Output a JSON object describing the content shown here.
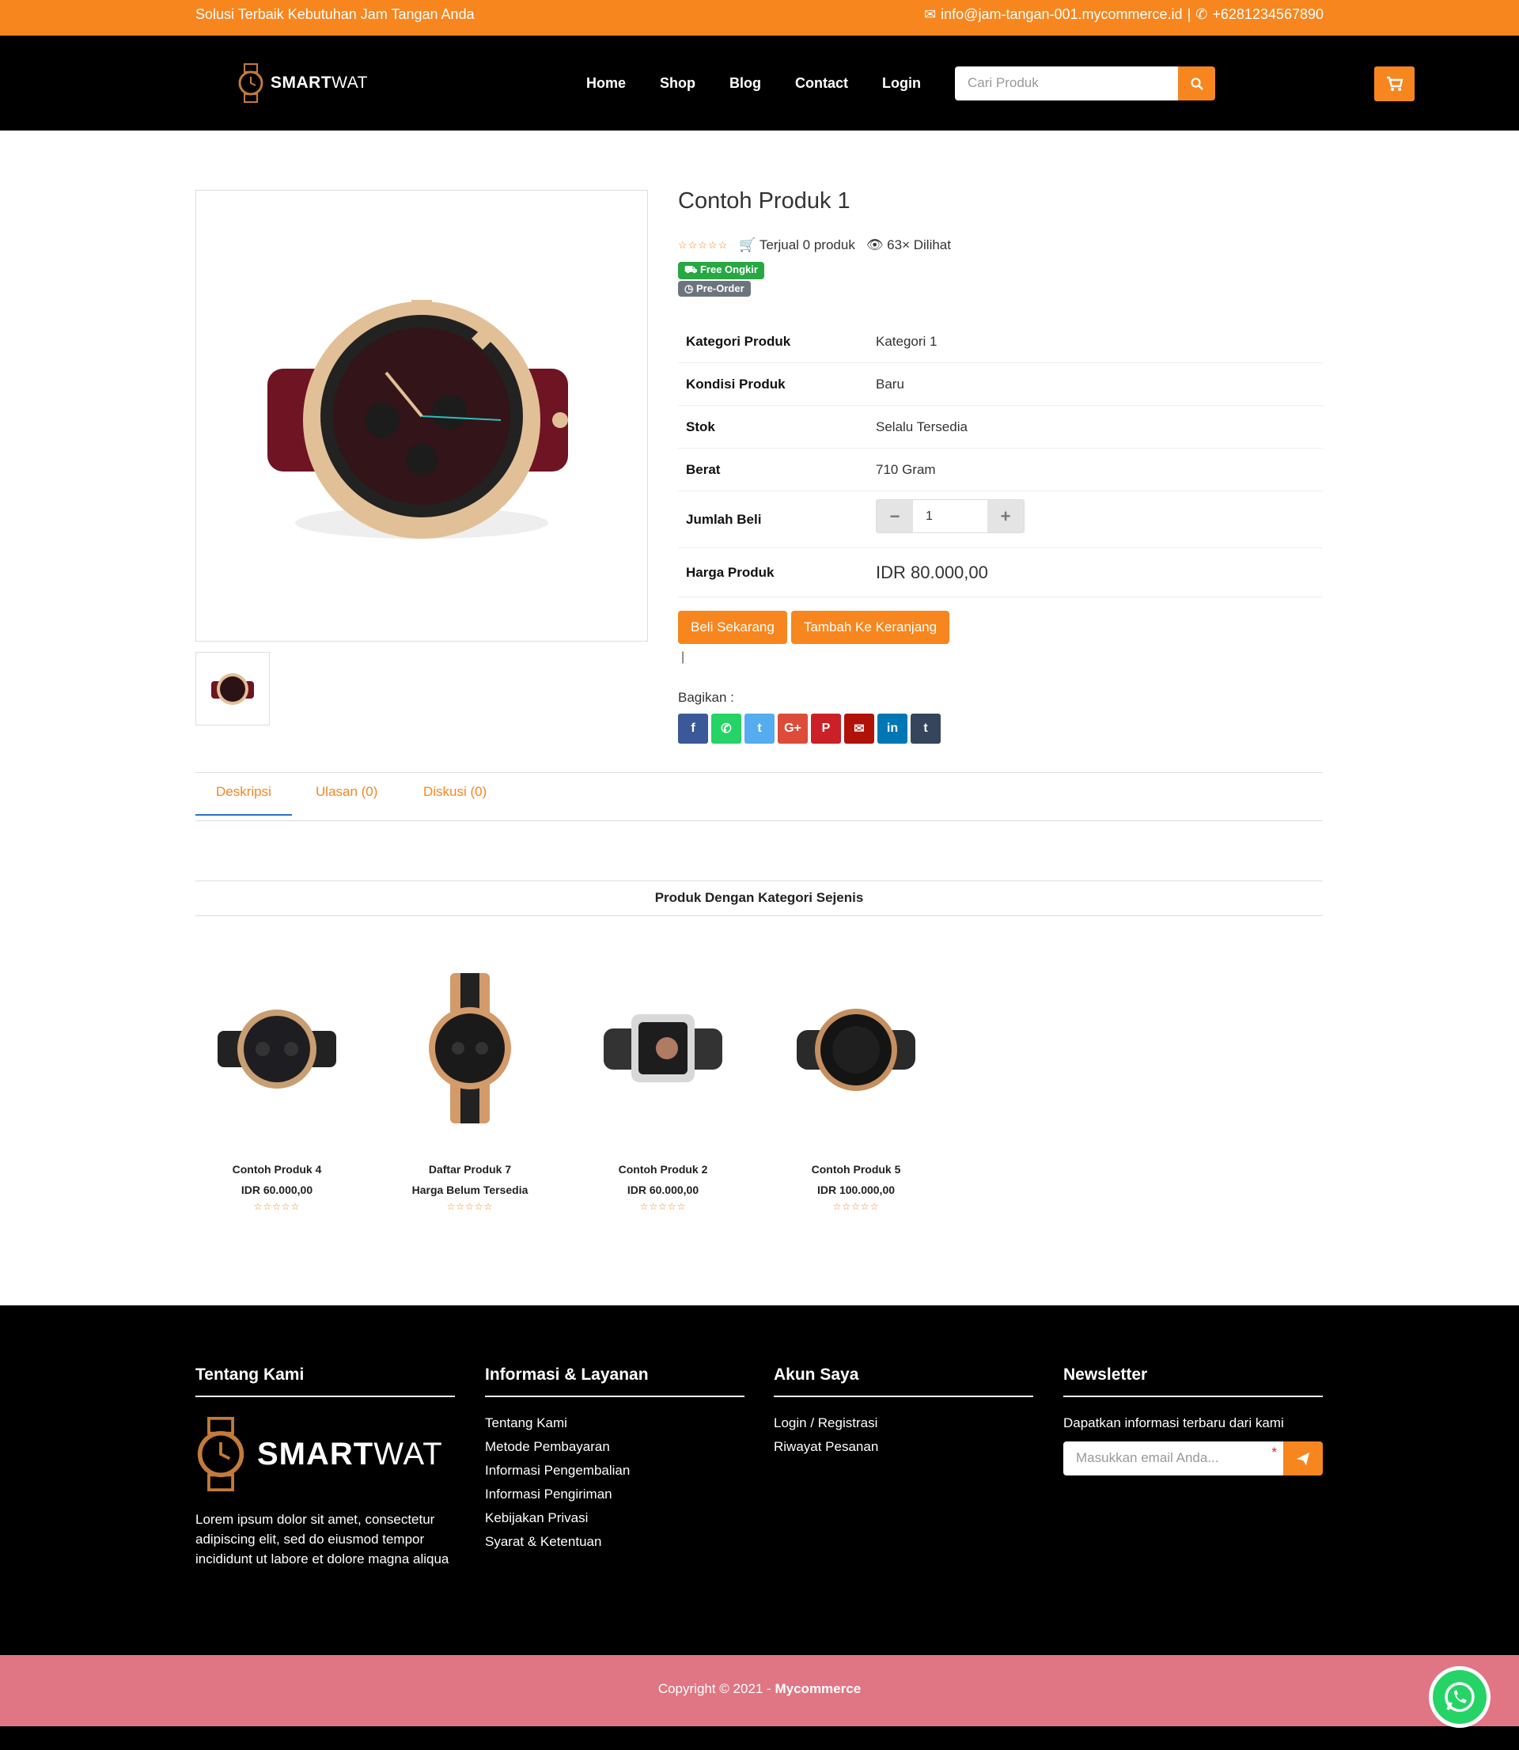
{
  "topbar": {
    "tagline": "Solusi Terbaik Kebutuhan Jam Tangan Anda",
    "email": "info@jam-tangan-001.mycommerce.id",
    "separator": "|",
    "phone": "+6281234567890"
  },
  "header": {
    "logo_smart": "SMART",
    "logo_wat": "WAT",
    "menu": [
      "Home",
      "Shop",
      "Blog",
      "Contact",
      "Login"
    ],
    "search_placeholder": "Cari Produk"
  },
  "product": {
    "title": "Contoh Produk 1",
    "sold": "Terjual 0 produk",
    "views": "63× Dilihat",
    "badge_free": "Free Ongkir",
    "badge_preorder": "Pre-Order",
    "specs": [
      {
        "label": "Kategori Produk",
        "value": "Kategori 1"
      },
      {
        "label": "Kondisi Produk",
        "value": "Baru"
      },
      {
        "label": "Stok",
        "value": "Selalu Tersedia"
      },
      {
        "label": "Berat",
        "value": "710 Gram"
      },
      {
        "label": "Jumlah Beli",
        "value": "1"
      },
      {
        "label": "Harga Produk",
        "value": "IDR 80.000,00"
      }
    ],
    "buy_now": "Beli Sekarang",
    "add_cart": "Tambah Ke Keranjang",
    "cursor_mark": "|",
    "share_label": "Bagikan :",
    "share_icons": [
      "facebook-icon",
      "whatsapp-icon",
      "twitter-icon",
      "google-plus-icon",
      "pinterest-icon",
      "email-icon",
      "linkedin-icon",
      "tumblr-icon"
    ],
    "share_glyphs": [
      "f",
      "✆",
      "t",
      "G+",
      "P",
      "✉",
      "in",
      "t"
    ],
    "share_colors": [
      "#3b5998",
      "#25d366",
      "#55acee",
      "#dd4b39",
      "#cb2027",
      "#b0120a",
      "#0077b5",
      "#35465c"
    ]
  },
  "tabs": [
    "Deskripsi",
    "Ulasan (0)",
    "Diskusi (0)"
  ],
  "related": {
    "heading": "Produk Dengan Kategori Sejenis",
    "items": [
      {
        "name": "Contoh Produk 4",
        "price": "IDR 60.000,00"
      },
      {
        "name": "Daftar Produk 7",
        "price": "Harga Belum Tersedia"
      },
      {
        "name": "Contoh Produk 2",
        "price": "IDR 60.000,00"
      },
      {
        "name": "Contoh Produk 5",
        "price": "IDR 100.000,00"
      }
    ]
  },
  "footer": {
    "about_title": "Tentang Kami",
    "about_text": "Lorem ipsum dolor sit amet, consectetur adipiscing elit, sed do eiusmod tempor incididunt ut labore et dolore magna aliqua",
    "info_title": "Informasi & Layanan",
    "info_links": [
      "Tentang Kami",
      "Metode Pembayaran",
      "Informasi Pengembalian",
      "Informasi Pengiriman",
      "Kebijakan Privasi",
      "Syarat & Ketentuan"
    ],
    "account_title": "Akun Saya",
    "account_links": [
      "Login / Registrasi",
      "Riwayat Pesanan"
    ],
    "newsletter_title": "Newsletter",
    "newsletter_text": "Dapatkan informasi terbaru dari kami",
    "newsletter_placeholder": "Masukkan email Anda...",
    "required_mark": "*"
  },
  "copyright": {
    "text": "Copyright © 2021 - ",
    "brand": "Mycommerce"
  },
  "colors": {
    "accent": "#f7861f",
    "footer_bar": "#e07683",
    "badge_green": "#28a745",
    "badge_gray": "#6c757d"
  }
}
